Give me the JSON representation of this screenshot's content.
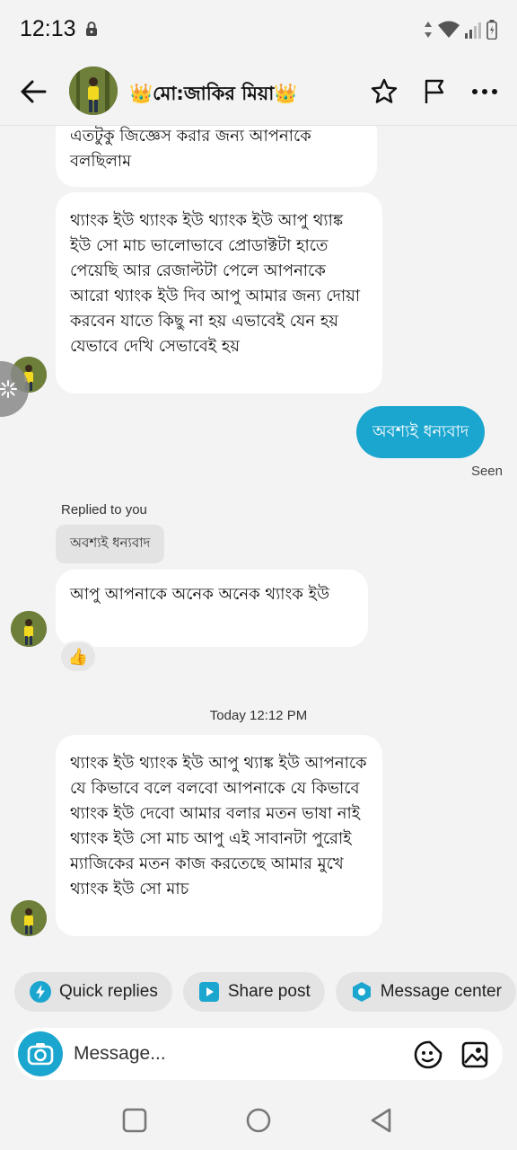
{
  "status_bar": {
    "time": "12:13"
  },
  "header": {
    "name": "👑মো:জাকির মিয়া👑"
  },
  "messages": {
    "m1": "এতটুকু জিজ্ঞেস করার জন্য আপনাকে বলছিলাম",
    "m2": "থ্যাংক ইউ থ্যাংক ইউ থ্যাংক ইউ আপু থ্যাঙ্ক ইউ সো মাচ ভালোভাবে প্রোডাক্টটা হাতে পেয়েছি আর রেজাল্টটা পেলে আপনাকে আরো থ্যাংক ইউ দিব আপু আমার জন্য দোয়া করবেন যাতে কিছু না হয় এভাবেই যেন হয় যেভাবে দেখি সেভাবেই হয়",
    "m3_out": "অবশ্যই ধন্যবাদ",
    "seen": "Seen",
    "replied_label": "Replied to you",
    "replied_quote": "অবশ্যই ধন্যবাদ",
    "m4": "আপু আপনাকে অনেক অনেক থ্যাংক ইউ",
    "reaction": "👍",
    "timestamp": "Today 12:12 PM",
    "m5": "থ্যাংক ইউ থ্যাংক ইউ আপু থ্যাঙ্ক ইউ আপনাকে যে কিভাবে বলে বলবো আপনাকে যে কিভাবে থ্যাংক ইউ দেবো আমার বলার মতন ভাষা নাই থ্যাংক ইউ সো মাচ আপু এই সাবানটা পুরোই ম্যাজিকের মতন কাজ করতেছে আমার মুখে থ্যাংক ইউ সো মাচ"
  },
  "chips": {
    "quick_replies": "Quick replies",
    "share_post": "Share post",
    "message_center": "Message center"
  },
  "composer": {
    "placeholder": "Message..."
  },
  "colors": {
    "accent": "#1ba6cf",
    "bubble_in": "#ffffff",
    "background": "#f3f3f3"
  }
}
